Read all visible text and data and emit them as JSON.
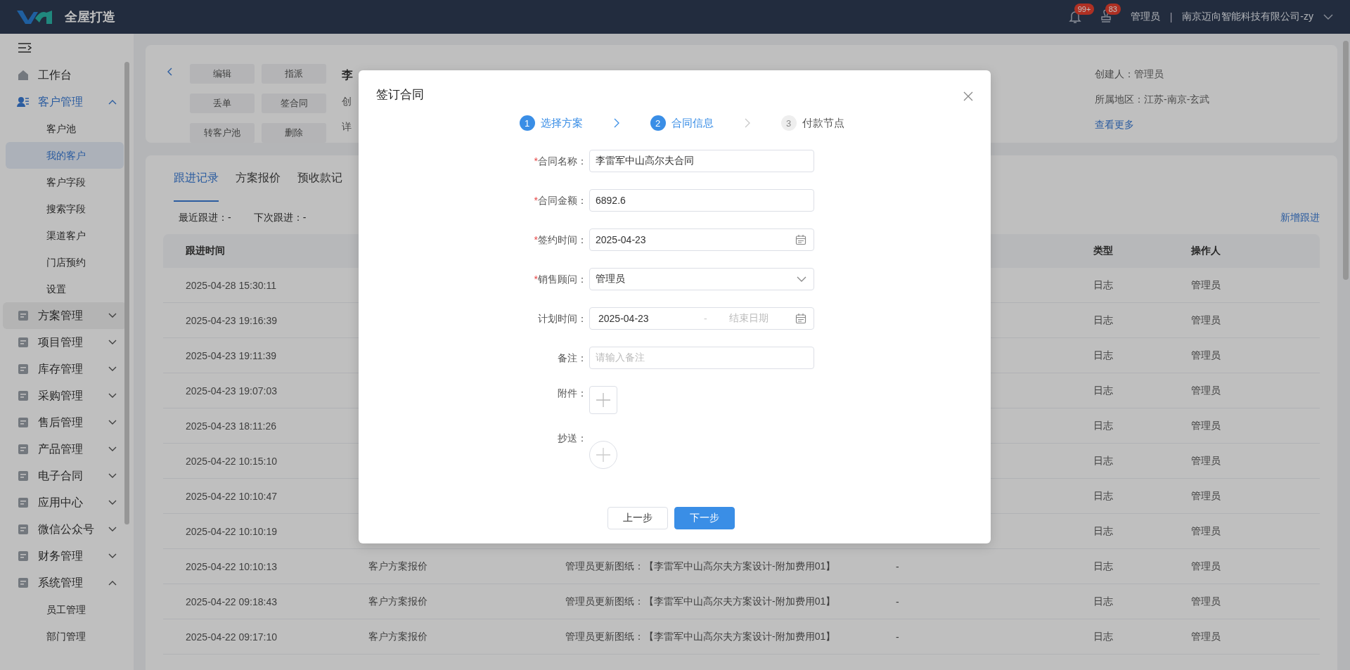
{
  "header": {
    "logo_text": "全屋打造",
    "notifications": [
      {
        "badge": "99+"
      },
      {
        "badge": "83"
      }
    ],
    "user": "管理员",
    "separator": "|",
    "company": "南京迈向智能科技有限公司-zy"
  },
  "sidebar": {
    "items": [
      {
        "label": "工作台",
        "active": false,
        "hovered": false
      },
      {
        "label": "客户管理",
        "active": true,
        "hovered": false,
        "expanded": true,
        "children": [
          {
            "label": "客户池",
            "selected": false
          },
          {
            "label": "我的客户",
            "selected": true
          },
          {
            "label": "客户字段",
            "selected": false
          },
          {
            "label": "搜索字段",
            "selected": false
          },
          {
            "label": "渠道客户",
            "selected": false
          },
          {
            "label": "门店预约",
            "selected": false
          },
          {
            "label": "设置",
            "selected": false
          }
        ]
      },
      {
        "label": "方案管理",
        "active": false,
        "hovered": true,
        "expanded": false
      },
      {
        "label": "项目管理",
        "active": false,
        "hovered": false,
        "expanded": false
      },
      {
        "label": "库存管理",
        "active": false,
        "hovered": false,
        "expanded": false
      },
      {
        "label": "采购管理",
        "active": false,
        "hovered": false,
        "expanded": false
      },
      {
        "label": "售后管理",
        "active": false,
        "hovered": false,
        "expanded": false
      },
      {
        "label": "产品管理",
        "active": false,
        "hovered": false,
        "expanded": false
      },
      {
        "label": "电子合同",
        "active": false,
        "hovered": false,
        "expanded": false
      },
      {
        "label": "应用中心",
        "active": false,
        "hovered": false,
        "expanded": false
      },
      {
        "label": "微信公众号",
        "active": false,
        "hovered": false,
        "expanded": false
      },
      {
        "label": "财务管理",
        "active": false,
        "hovered": false,
        "expanded": false
      },
      {
        "label": "系统管理",
        "active": false,
        "hovered": false,
        "expanded": true,
        "children": [
          {
            "label": "员工管理",
            "selected": false
          },
          {
            "label": "部门管理",
            "selected": false
          }
        ]
      }
    ]
  },
  "detail_card": {
    "actions": [
      "编辑",
      "指派",
      "丢单",
      "签合同",
      "转客户池",
      "删除"
    ],
    "partial_lines": [
      "李",
      "创",
      "详"
    ],
    "info": [
      "创建人：管理员",
      "所属地区：江苏-南京-玄武"
    ],
    "more_link": "查看更多"
  },
  "tabs": [
    {
      "label": "跟进记录",
      "selected": true
    },
    {
      "label": "方案报价",
      "selected": false
    },
    {
      "label": "预收款记",
      "selected": false
    }
  ],
  "summary": [
    "最近跟进：-",
    "下次跟进：-"
  ],
  "add_link": "新增跟进",
  "table": {
    "columns": [
      "跟进时间",
      "类型",
      "操作人"
    ],
    "rows": [
      {
        "time": "2025-04-28 15:30:11",
        "type": "日志",
        "operator": "管理员"
      },
      {
        "time": "2025-04-23 19:16:39",
        "type": "日志",
        "operator": "管理员"
      },
      {
        "time": "2025-04-23 19:11:39",
        "type": "日志",
        "operator": "管理员"
      },
      {
        "time": "2025-04-23 19:07:03",
        "type": "日志",
        "operator": "管理员"
      },
      {
        "time": "2025-04-23 18:11:26",
        "type": "日志",
        "operator": "管理员"
      },
      {
        "time": "2025-04-22 10:15:10",
        "type": "日志",
        "operator": "管理员"
      },
      {
        "time": "2025-04-22 10:10:47",
        "type": "日志",
        "operator": "管理员"
      },
      {
        "time": "2025-04-22 10:10:19",
        "type": "日志",
        "operator": "管理员"
      },
      {
        "time": "2025-04-22 10:10:13",
        "column_2": "客户方案报价",
        "column_3": "管理员更新图纸：【李雷军中山高尔夫方案设计-附加费用01】",
        "column_4": "-",
        "type": "日志",
        "operator": "管理员"
      },
      {
        "time": "2025-04-22 09:18:43",
        "column_2": "客户方案报价",
        "column_3": "管理员更新图纸：【李雷军中山高尔夫方案设计-附加费用01】",
        "column_4": "-",
        "type": "日志",
        "operator": "管理员"
      },
      {
        "time": "2025-04-22 09:17:10",
        "column_2": "客户方案报价",
        "column_3": "管理员更新图纸：【李雷军中山高尔夫方案设计-附加费用01】",
        "column_4": "-",
        "type": "日志",
        "operator": "管理员"
      }
    ]
  },
  "dialog": {
    "title": "签订合同",
    "steps": [
      {
        "number": "1",
        "label": "选择方案",
        "reached": true
      },
      {
        "number": "2",
        "label": "合同信息",
        "reached": true
      },
      {
        "number": "3",
        "label": "付款节点",
        "reached": false
      }
    ],
    "fields": [
      {
        "kind": "text",
        "mark": "*",
        "label": "合同名称：",
        "value": "李雷军中山高尔夫合同"
      },
      {
        "kind": "text",
        "mark": "*",
        "label": "合同金额：",
        "value": "6892.6"
      },
      {
        "kind": "date",
        "mark": "*",
        "label": "签约时间：",
        "value": "2025-04-23"
      },
      {
        "kind": "select",
        "mark": "*",
        "label": "销售顾问：",
        "value": "管理员"
      },
      {
        "kind": "range",
        "label": "计划时间：",
        "start": "2025-04-23",
        "separator": "-",
        "end_placeholder": "结束日期"
      },
      {
        "kind": "text",
        "label": "备注：",
        "placeholder": "请输入备注"
      },
      {
        "kind": "upload",
        "label": "附件："
      },
      {
        "kind": "add_person",
        "label": "抄送："
      }
    ],
    "buttons": [
      {
        "label": "上一步",
        "kind": "secondary"
      },
      {
        "label": "下一步",
        "kind": "primary"
      }
    ]
  }
}
